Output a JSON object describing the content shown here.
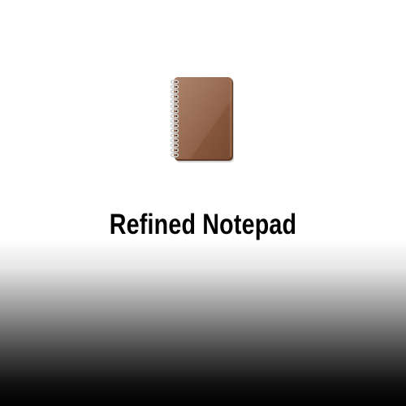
{
  "app": {
    "title": "Refined Notepad",
    "icon": "notepad-icon"
  },
  "colors": {
    "cover": "#8a5a3e",
    "cover_dark": "#6e432c",
    "spiral": "#d9d9d9",
    "title_text": "#000000",
    "background_top": "#ffffff",
    "background_bottom": "#000000"
  }
}
